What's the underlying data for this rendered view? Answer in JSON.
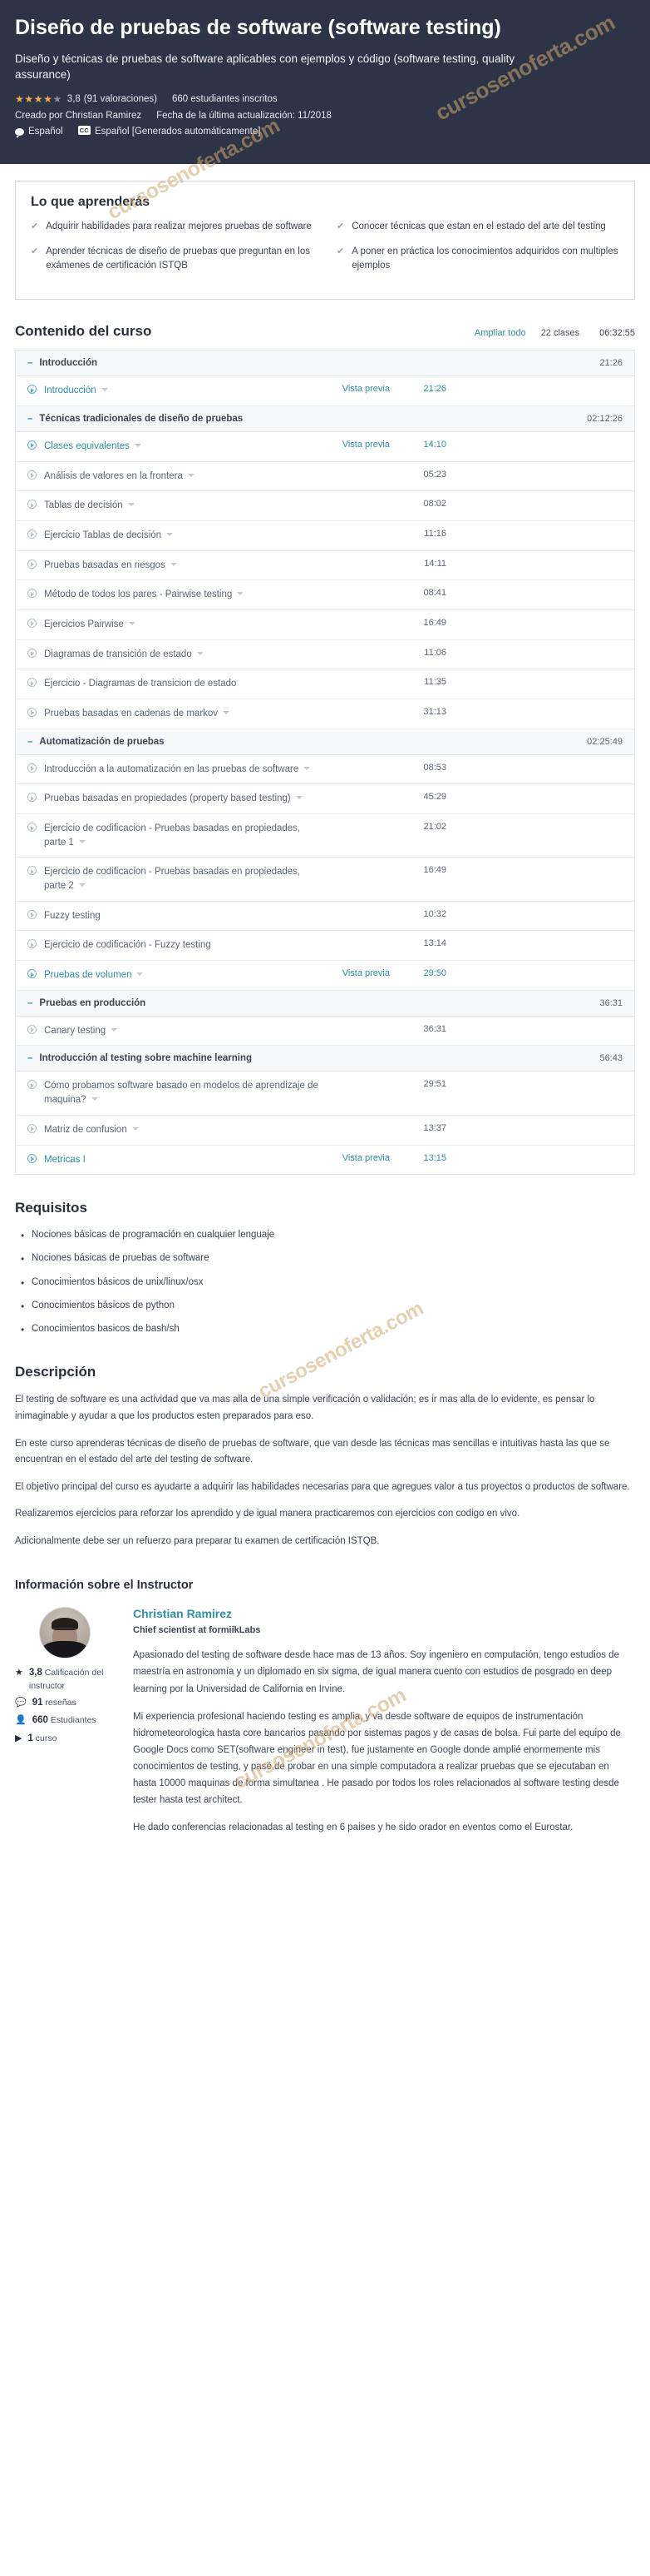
{
  "hero": {
    "title": "Diseño de pruebas de software (software testing)",
    "subtitle": "Diseño y técnicas de pruebas de software aplicables con ejemplos y código (software testing, quality assurance)",
    "rating_value": "3,8",
    "rating_count": "(91 valoraciones)",
    "students": "660 estudiantes inscritos",
    "created_by": "Creado por Christian Ramirez",
    "last_update": "Fecha de la última actualización: 11/2018",
    "language": "Español",
    "captions": "Español [Generados automáticamente]",
    "stars_filled": 4,
    "stars_total": 5,
    "bg_color": "#2d3446",
    "star_color": "#f0ad4e"
  },
  "learn": {
    "title": "Lo que aprenderás",
    "items_left": [
      "Adquirir habilidades para realizar mejores pruebas de software",
      "Aprender técnicas de diseño de pruebas que preguntan en los exámenes de certificación ISTQB"
    ],
    "items_right": [
      "Conocer técnicas que estan en el estado del arte del testing",
      "A poner en práctica los conocimientos adquiridos con multiples ejemplos"
    ]
  },
  "curriculum": {
    "title": "Contenido del curso",
    "expand_all": "Ampliar todo",
    "lecture_count": "22 clases",
    "total_duration": "06:32:55",
    "preview_label": "Vista previa",
    "sections": [
      {
        "name": "Introducción",
        "duration": "21:26",
        "lectures": [
          {
            "title": "Introducción",
            "duration": "21:26",
            "preview": true,
            "caret": true
          }
        ]
      },
      {
        "name": "Técnicas tradicionales de diseño de pruebas",
        "duration": "02:12:26",
        "lectures": [
          {
            "title": "Clases equivalentes",
            "duration": "14:10",
            "preview": true,
            "caret": true
          },
          {
            "title": "Análisis de valores en la frontera",
            "duration": "05:23",
            "preview": false,
            "caret": true
          },
          {
            "title": "Tablas de decisión",
            "duration": "08:02",
            "preview": false,
            "caret": true
          },
          {
            "title": "Ejercicio Tablas de decisión",
            "duration": "11:16",
            "preview": false,
            "caret": true
          },
          {
            "title": "Pruebas basadas en riesgos",
            "duration": "14:11",
            "preview": false,
            "caret": true
          },
          {
            "title": "Método de todos los pares - Pairwise testing",
            "duration": "08:41",
            "preview": false,
            "caret": true
          },
          {
            "title": "Ejercicios Pairwise",
            "duration": "16:49",
            "preview": false,
            "caret": true
          },
          {
            "title": "Diagramas de transición de estado",
            "duration": "11:06",
            "preview": false,
            "caret": true
          },
          {
            "title": "Ejercicio - Diagramas de transicion de estado",
            "duration": "11:35",
            "preview": false,
            "caret": false
          },
          {
            "title": "Pruebas basadas en cadenas de markov",
            "duration": "31:13",
            "preview": false,
            "caret": true
          }
        ]
      },
      {
        "name": "Automatización de pruebas",
        "duration": "02:25:49",
        "lectures": [
          {
            "title": "Introducción a la automatización en las pruebas de software",
            "duration": "08:53",
            "preview": false,
            "caret": true
          },
          {
            "title": "Pruebas basadas en propiedades (property based testing)",
            "duration": "45:29",
            "preview": false,
            "caret": true
          },
          {
            "title": "Ejercicio de codificacion - Pruebas basadas en propiedades, parte 1",
            "duration": "21:02",
            "preview": false,
            "caret": true
          },
          {
            "title": "Ejercicio de codificacion - Pruebas basadas en propiedades, parte 2",
            "duration": "16:49",
            "preview": false,
            "caret": true
          },
          {
            "title": "Fuzzy testing",
            "duration": "10:32",
            "preview": false,
            "caret": false
          },
          {
            "title": "Ejercicio de codificación - Fuzzy testing",
            "duration": "13:14",
            "preview": false,
            "caret": false
          },
          {
            "title": "Pruebas de volumen",
            "duration": "29:50",
            "preview": true,
            "caret": true
          }
        ]
      },
      {
        "name": "Pruebas en producción",
        "duration": "36:31",
        "lectures": [
          {
            "title": "Canary testing",
            "duration": "36:31",
            "preview": false,
            "caret": true
          }
        ]
      },
      {
        "name": "Introducción al testing sobre machine learning",
        "duration": "56:43",
        "lectures": [
          {
            "title": "Cómo probamos software basado en modelos de aprendizaje de maquina?",
            "duration": "29:51",
            "preview": false,
            "caret": true
          },
          {
            "title": "Matriz de confusion",
            "duration": "13:37",
            "preview": false,
            "caret": true
          },
          {
            "title": "Metricas I",
            "duration": "13:15",
            "preview": true,
            "caret": false
          }
        ]
      }
    ]
  },
  "requirements": {
    "title": "Requisitos",
    "items": [
      "Nociones básicas de programación en cualquier lenguaje",
      "Nociones básicas de pruebas de software",
      "Conocimientos básicos de unix/linux/osx",
      "Conocimientos básicos de python",
      "Conocimientos basicos de bash/sh"
    ]
  },
  "description": {
    "title": "Descripción",
    "paragraphs": [
      "El testing de software es una actividad que va mas alla de una simple verificación o validación; es ir mas alla de lo evidente, es pensar lo inimaginable y ayudar a que los productos esten preparados para eso.",
      "En este curso aprenderas técnicas de diseño de pruebas de software, que van desde las técnicas mas sencillas e intuitivas hasta las que se encuentran en el estado del arte del testing de software.",
      "El objetivo principal del curso es ayudarte a adquirir las habilidades necesarias para que agregues valor a tus proyectos o productos de software.",
      "Realizaremos ejercicios para reforzar los aprendido y de igual manera practicaremos con ejercicios con codigo en vivo.",
      "Adicionalmente debe ser un refuerzo para preparar tu examen de certificación ISTQB."
    ]
  },
  "instructor": {
    "section_title": "Información sobre el Instructor",
    "name": "Christian Ramirez",
    "role": "Chief scientist at formiikLabs",
    "stats": [
      {
        "icon": "star-icon",
        "glyph": "★",
        "value": "3,8",
        "label": "Calificación del instructor"
      },
      {
        "icon": "review-bubble-icon",
        "glyph": "💬",
        "value": "91",
        "label": "reseñas"
      },
      {
        "icon": "user-icon",
        "glyph": "👤",
        "value": "660",
        "label": "Estudiantes"
      },
      {
        "icon": "play-circle-icon",
        "glyph": "▶",
        "value": "1",
        "label": "curso"
      }
    ],
    "bio": [
      "Apasionado del testing de software desde hace mas de 13 años. Soy ingeniero en computación, tengo estudios de maestría en astronomía y un diplomado en six sigma, de igual manera cuento con estudios de posgrado en deep learning por la Universidad de California en Irvine.",
      "Mi experiencia profesional haciendo testing es amplia, y va desde software de equipos de instrumentación hidrometeorologica hasta core bancarios pasando por sistemas pagos y de casas de bolsa. Fui parte del equipo de Google Docs como SET(software engineer in test), fue justamente en Google donde amplié enormemente mis conocimientos de testing, y pasé de probar en una simple computadora a realizar pruebas que se ejecutaban en hasta 10000 maquinas de forma simultanea . He pasado por todos los roles relacionados al software testing desde tester hasta test architect.",
      "He dado conferencias relacionadas al testing en 6 paises y he sido orador en eventos como el Eurostar."
    ]
  },
  "watermark": {
    "text": "cursosenoferta.com",
    "color": "#cda870"
  }
}
